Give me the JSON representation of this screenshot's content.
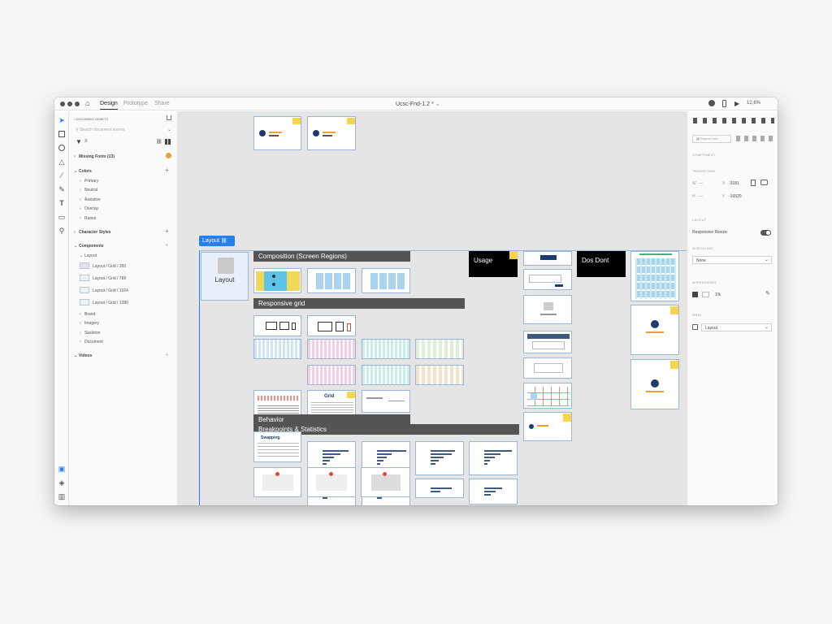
{
  "titlebar": {
    "tabs": [
      "Design",
      "Prototype",
      "Share"
    ],
    "file_name": "Ucsc-Fnd-1.2 *",
    "zoom": "12,6%"
  },
  "assets": {
    "header": "DOCUMENT ASSETS",
    "search_placeholder": "Search document assets",
    "missing_fonts": "Missing Fonts (13)",
    "colors_head": "Colors",
    "colors": [
      "Primary",
      "Neutral",
      "Assistive",
      "Overlay",
      "Ratios"
    ],
    "character_styles": "Character Styles",
    "components_head": "Components",
    "layout_group": "Layout",
    "layout_items": [
      "Layout / Grid / 360",
      "Layout / Grid / 768",
      "Layout / Grid / 1024",
      "Layout / Grid / 1280"
    ],
    "component_groups": [
      "Brand",
      "Imagery",
      "Skeleton",
      "Document"
    ],
    "videos": "Videos"
  },
  "canvas": {
    "layout_tag": "Layout",
    "layout_card": "Layout",
    "sections": {
      "composition": "Composition (Screen Regions)",
      "responsive": "Responsive grid",
      "breakpoints": "Breakpoints & Statistics",
      "behavior": "Behavior"
    },
    "usage": "Usage",
    "dos_dont": "Dos Dont",
    "grid_card": "Grid",
    "swapping_card": "Swapping"
  },
  "inspector": {
    "repeat_grid": "Repeat Grid",
    "component": "COMPONENT",
    "transform": "TRANSFORM",
    "w_label": "W",
    "h_label": "H",
    "w_value": "—",
    "h_value": "—",
    "x_label": "X",
    "y_label": "Y",
    "x_value": "-3181",
    "y_value": "-16520",
    "layout_section": "LAYOUT",
    "responsive_resize": "Responsive Resize",
    "responsive_resize_on": true,
    "scrolling": "SCROLLING",
    "scrolling_value": "None",
    "appearance": "APPEARANCE",
    "opacity": "1%",
    "grid": "GRID",
    "grid_value": "Layout"
  },
  "colors": {
    "selection": "#2680eb",
    "section_header": "#545454",
    "sticky": "#f7d54b",
    "frame_border": "#9ab7d9"
  }
}
